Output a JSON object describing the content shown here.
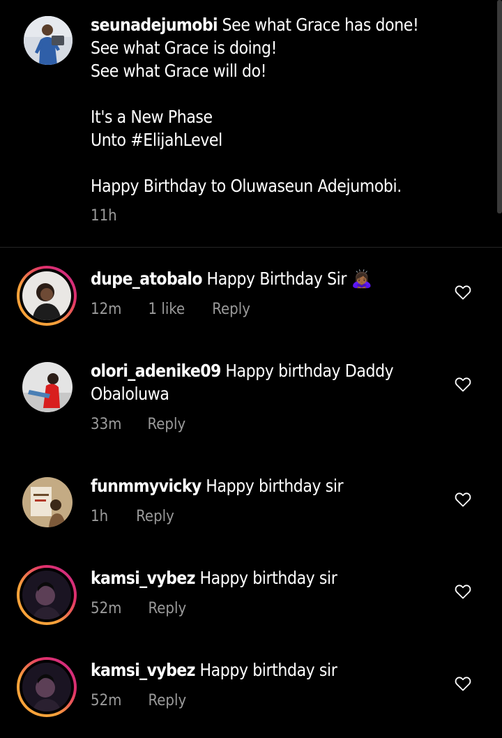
{
  "caption": {
    "username": "seunadejumobi",
    "text": " See what Grace has done!\nSee what Grace is doing!\nSee what Grace will do!\n\nIt's a New Phase\nUnto #ElijahLevel\n\nHappy Birthday to Oluwaseun Adejumobi.",
    "time": "11h"
  },
  "comments": [
    {
      "username": "dupe_atobalo",
      "text": " Happy Birthday Sir 🙇🏾‍♀️",
      "time": "12m",
      "likes": "1 like",
      "reply": "Reply"
    },
    {
      "username": "olori_adenike09",
      "text": " Happy birthday Daddy Obaloluwa",
      "time": "33m",
      "reply": "Reply"
    },
    {
      "username": "funmmyvicky",
      "text": " Happy birthday sir",
      "time": "1h",
      "reply": "Reply"
    },
    {
      "username": "kamsi_vybez",
      "text": " Happy birthday sir",
      "time": "52m",
      "reply": "Reply"
    },
    {
      "username": "kamsi_vybez",
      "text": " Happy birthday sir",
      "time": "52m",
      "reply": "Reply"
    }
  ],
  "icons": {
    "like": "heart-outline-icon"
  },
  "colors": {
    "background": "#000000",
    "text": "#ffffff",
    "secondary_text": "#9a9a9a",
    "story_ring_start": "#f9a23a",
    "story_ring_end": "#c42c8e"
  }
}
